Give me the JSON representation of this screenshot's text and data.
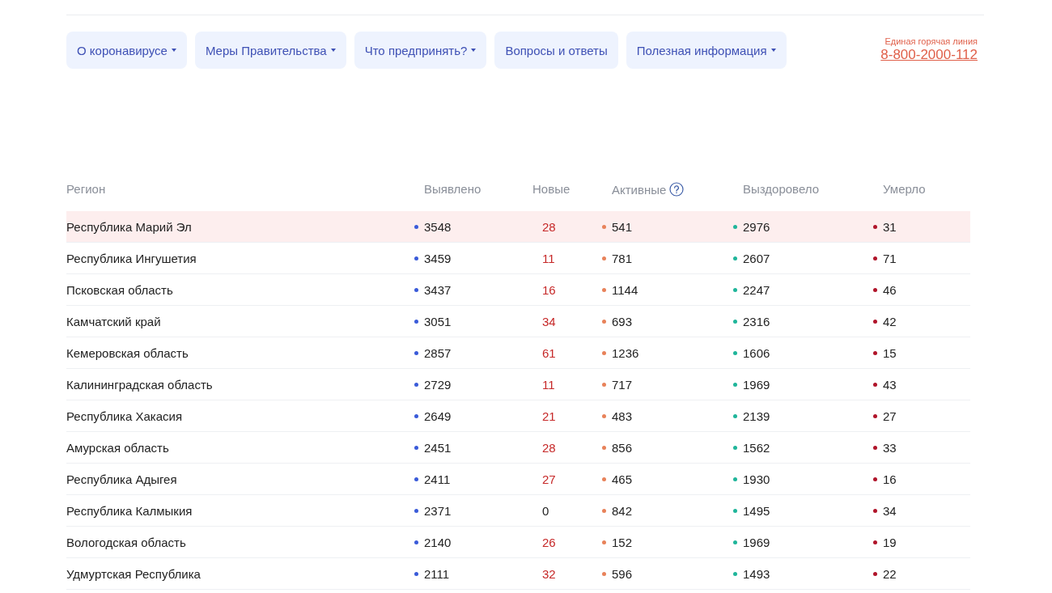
{
  "nav": [
    {
      "label": "О коронавирусе",
      "dropdown": true
    },
    {
      "label": "Меры Правительства",
      "dropdown": true
    },
    {
      "label": "Что предпринять?",
      "dropdown": true
    },
    {
      "label": "Вопросы и ответы",
      "dropdown": false
    },
    {
      "label": "Полезная информация",
      "dropdown": true
    }
  ],
  "hotline": {
    "label": "Единая горячая линия",
    "phone": "8-800-2000-112"
  },
  "table": {
    "columns": [
      {
        "label": "Регион",
        "help": false
      },
      {
        "label": "Выявлено",
        "help": false,
        "color": "#3a5bd9"
      },
      {
        "label": "Новые",
        "help": false
      },
      {
        "label": "Активные",
        "help": true,
        "color": "#e8825a"
      },
      {
        "label": "Выздоровело",
        "help": false,
        "color": "#1fb59a"
      },
      {
        "label": "Умерло",
        "help": false,
        "color": "#b0142a"
      }
    ],
    "rows": [
      {
        "region": "Республика Марий Эл",
        "highlighted": true,
        "detected": "3548",
        "new": {
          "value": "28",
          "increase": true
        },
        "active": "541",
        "recovered": "2976",
        "died": "31"
      },
      {
        "region": "Республика Ингушетия",
        "highlighted": false,
        "detected": "3459",
        "new": {
          "value": "11",
          "increase": true
        },
        "active": "781",
        "recovered": "2607",
        "died": "71"
      },
      {
        "region": "Псковская область",
        "highlighted": false,
        "detected": "3437",
        "new": {
          "value": "16",
          "increase": true
        },
        "active": "1144",
        "recovered": "2247",
        "died": "46"
      },
      {
        "region": "Камчатский край",
        "highlighted": false,
        "detected": "3051",
        "new": {
          "value": "34",
          "increase": true
        },
        "active": "693",
        "recovered": "2316",
        "died": "42"
      },
      {
        "region": "Кемеровская область",
        "highlighted": false,
        "detected": "2857",
        "new": {
          "value": "61",
          "increase": true
        },
        "active": "1236",
        "recovered": "1606",
        "died": "15"
      },
      {
        "region": "Калининградская область",
        "highlighted": false,
        "detected": "2729",
        "new": {
          "value": "11",
          "increase": true
        },
        "active": "717",
        "recovered": "1969",
        "died": "43"
      },
      {
        "region": "Республика Хакасия",
        "highlighted": false,
        "detected": "2649",
        "new": {
          "value": "21",
          "increase": true
        },
        "active": "483",
        "recovered": "2139",
        "died": "27"
      },
      {
        "region": "Амурская область",
        "highlighted": false,
        "detected": "2451",
        "new": {
          "value": "28",
          "increase": true
        },
        "active": "856",
        "recovered": "1562",
        "died": "33"
      },
      {
        "region": "Республика Адыгея",
        "highlighted": false,
        "detected": "2411",
        "new": {
          "value": "27",
          "increase": true
        },
        "active": "465",
        "recovered": "1930",
        "died": "16"
      },
      {
        "region": "Республика Калмыкия",
        "highlighted": false,
        "detected": "2371",
        "new": {
          "value": "0",
          "increase": false
        },
        "active": "842",
        "recovered": "1495",
        "died": "34"
      },
      {
        "region": "Вологодская область",
        "highlighted": false,
        "detected": "2140",
        "new": {
          "value": "26",
          "increase": true
        },
        "active": "152",
        "recovered": "1969",
        "died": "19"
      },
      {
        "region": "Удмуртская Республика",
        "highlighted": false,
        "detected": "2111",
        "new": {
          "value": "32",
          "increase": true
        },
        "active": "596",
        "recovered": "1493",
        "died": "22"
      }
    ]
  }
}
